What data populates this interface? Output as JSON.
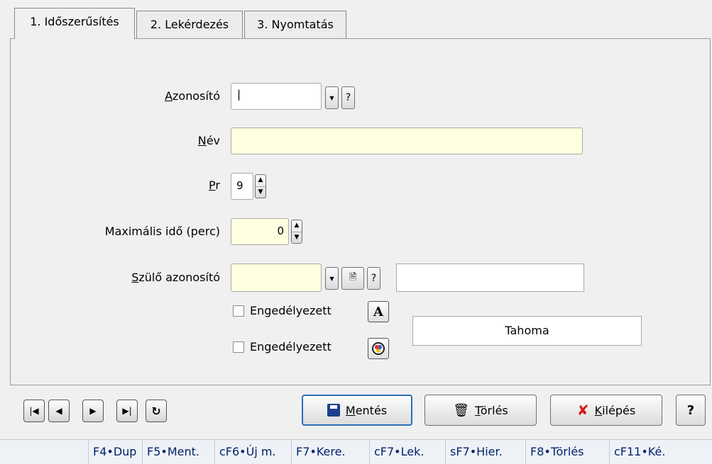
{
  "tabs": [
    {
      "label": "1. Időszerűsítés"
    },
    {
      "label": "2. Lekérdezés"
    },
    {
      "label": "3. Nyomtatás"
    }
  ],
  "form": {
    "azonosito": {
      "label_first": "A",
      "label_rest": "zonosító",
      "value": "|"
    },
    "nev": {
      "label_first": "N",
      "label_rest": "év",
      "value": ""
    },
    "pr": {
      "label_first": "P",
      "label_rest": "r",
      "value": "9"
    },
    "max_ido": {
      "label": "Maximális idő (perc)",
      "value": "0"
    },
    "szulo": {
      "label_first": "S",
      "label_rest": "zülő azonosító",
      "value": "",
      "name_value": ""
    },
    "checkbox1": {
      "label": "Engedélyezett",
      "checked": false
    },
    "checkbox2": {
      "label": "Engedélyezett",
      "checked": false
    },
    "font_box": "Tahoma",
    "help_glyph": "?",
    "font_button_glyph": "A"
  },
  "nav_buttons": [
    "first",
    "previous",
    "next",
    "last",
    "refresh"
  ],
  "actions": {
    "save": {
      "first": "M",
      "rest": "entés"
    },
    "delete": {
      "first": "T",
      "rest": "örlés"
    },
    "exit": {
      "first": "K",
      "rest": "ilépés"
    },
    "help": "?"
  },
  "status_bar": [
    "F4•Dup",
    "F5•Ment.",
    "cF6•Új m.",
    "F7•Kere.",
    "cF7•Lek.",
    "sF7•Hier.",
    "F8•Törlés",
    "cF11•Ké."
  ],
  "colors": {
    "input_yellow": "#ffffe1",
    "status_text": "#00246b",
    "delete_red": "#d11a1a"
  }
}
